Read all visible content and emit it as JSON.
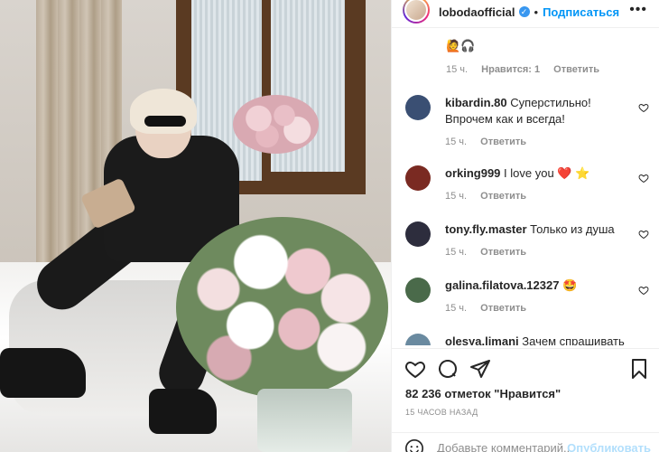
{
  "post": {
    "username": "lobodaofficial",
    "follow_label": "Подписаться",
    "dot": "•",
    "more": "•••"
  },
  "first_reply": {
    "emojis": "🙋🎧",
    "time": "15 ч.",
    "likes": "Нравится: 1",
    "reply": "Ответить"
  },
  "comments": [
    {
      "user": "kibardin.80",
      "text": "Суперстильно! Впрочем как и всегда!",
      "time": "15 ч.",
      "reply": "Ответить",
      "avatar_color": "#3a4f73"
    },
    {
      "user": "orking999",
      "text": "I love you ❤️ ⭐",
      "time": "15 ч.",
      "reply": "Ответить",
      "avatar_color": "#7a2a22"
    },
    {
      "user": "tony.fly.master",
      "text": "Только из душа",
      "time": "15 ч.",
      "reply": "Ответить",
      "avatar_color": "#2d2d3d"
    },
    {
      "user": "galina.filatova.12327",
      "text": "🤩",
      "time": "15 ч.",
      "reply": "Ответить",
      "avatar_color": "#4a6a4a"
    },
    {
      "user": "olesya.limani",
      "text": "Зачем спрашивать",
      "time": "",
      "reply": "",
      "avatar_color": "#6a8aa0"
    }
  ],
  "likes_text": "82 236 отметок \"Нравится\"",
  "time_ago": "15 ЧАСОВ НАЗАД",
  "add_comment": {
    "placeholder": "Добавьте комментарий...",
    "publish": "Опубликовать"
  },
  "colors": {
    "accent": "#0095f6",
    "verified": "#3897f0",
    "muted": "#8e8e8e"
  }
}
